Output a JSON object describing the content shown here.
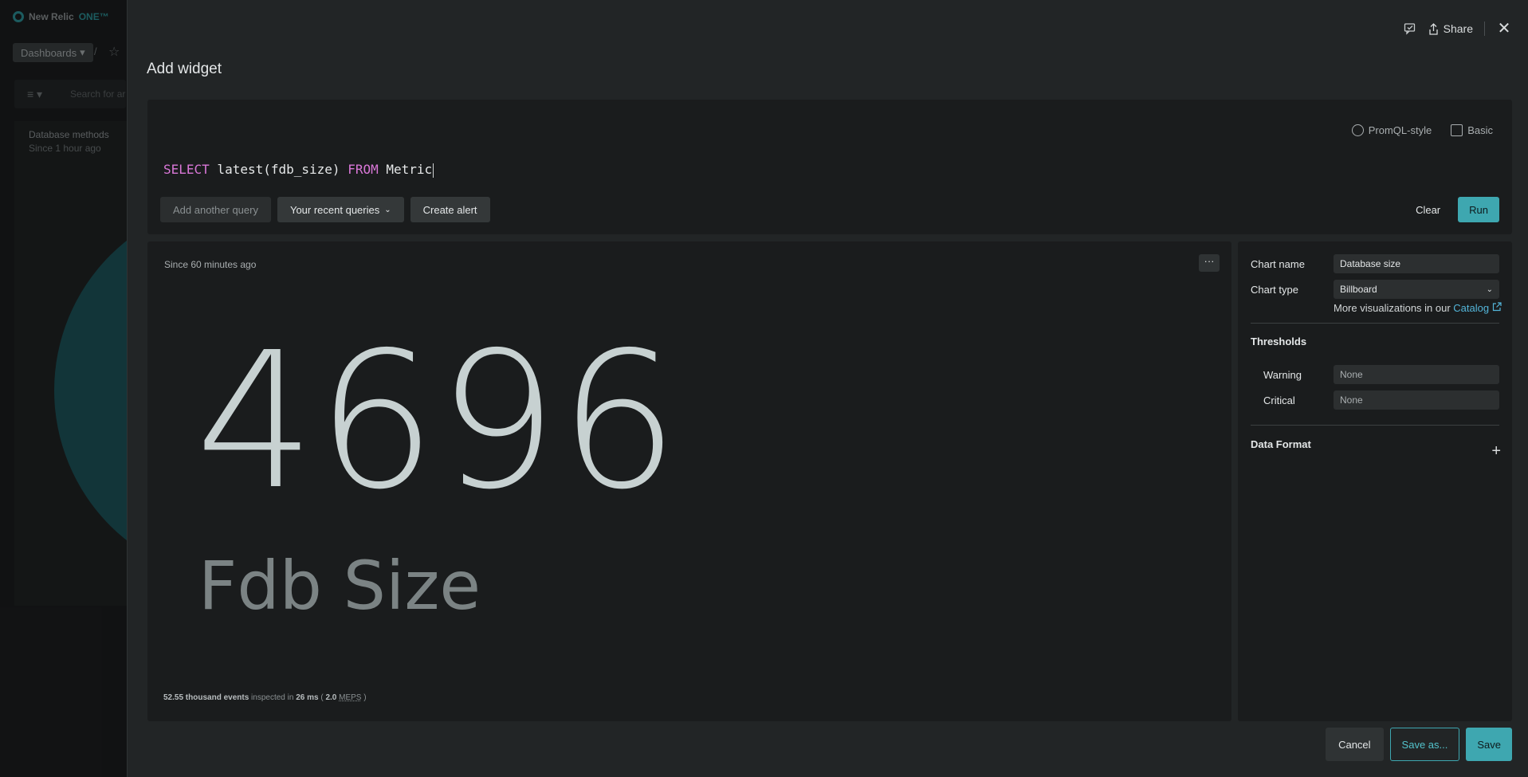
{
  "background": {
    "logo_text": "New Relic",
    "logo_one": "ONE™",
    "dashboards_label": "Dashboards",
    "breadcrumb_sep": "/",
    "search_placeholder": "Search for ar",
    "card_title": "Database methods",
    "card_subtitle": "Since 1 hour ago"
  },
  "modal": {
    "title": "Add widget",
    "share_label": "Share",
    "query": {
      "modes": [
        "PromQL-style",
        "Basic"
      ],
      "keyword_select": "SELECT",
      "expression": " latest(fdb_size) ",
      "keyword_from": "FROM",
      "source": " Metric",
      "add_query_label": "Add another query",
      "recent_queries_label": "Your recent queries",
      "create_alert_label": "Create alert",
      "clear_label": "Clear",
      "run_label": "Run"
    },
    "chart": {
      "since": "Since 60 minutes ago",
      "menu_glyph": "···",
      "value": "4696",
      "label": "Fdb Size",
      "footer_events": "52.55 thousand events",
      "footer_inspected": " inspected in ",
      "footer_ms": "26 ms",
      "footer_open": " ( ",
      "footer_rate": "2.0",
      "footer_unit": "MEPS",
      "footer_close": " )"
    },
    "settings": {
      "chart_name_label": "Chart name",
      "chart_name_value": "Database size",
      "chart_type_label": "Chart type",
      "chart_type_value": "Billboard",
      "more_text": "More visualizations in our ",
      "catalog_link": "Catalog",
      "thresholds_heading": "Thresholds",
      "warning_label": "Warning",
      "warning_value": "None",
      "critical_label": "Critical",
      "critical_value": "None",
      "data_format_heading": "Data Format"
    },
    "actions": {
      "cancel_label": "Cancel",
      "save_as_label": "Save as...",
      "save_label": "Save"
    }
  },
  "colors": {
    "accent": "#3ea7b0",
    "keyword": "#d977d7",
    "link": "#53b5d9"
  }
}
